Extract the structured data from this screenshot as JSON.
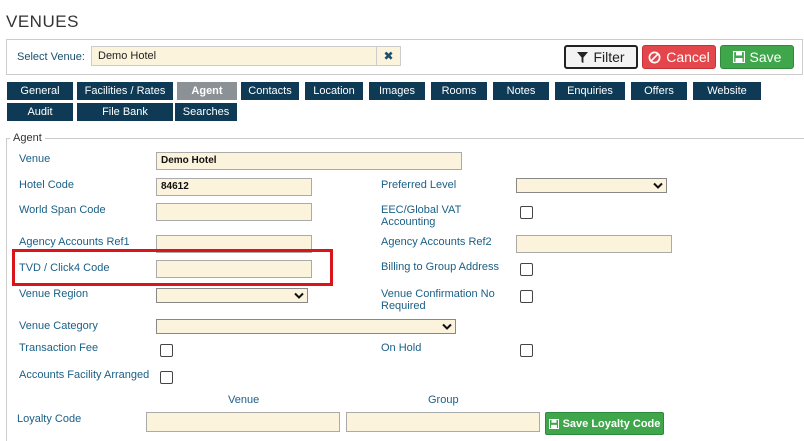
{
  "page": {
    "title": "VENUES"
  },
  "venue_bar": {
    "label": "Select Venue:",
    "selected": "Demo Hotel",
    "clear": "✖"
  },
  "buttons": {
    "filter": "Filter",
    "cancel": "Cancel",
    "save": "Save"
  },
  "tabs": [
    {
      "label": "General"
    },
    {
      "label": "Facilities / Rates"
    },
    {
      "label": "Agent"
    },
    {
      "label": "Contacts"
    },
    {
      "label": "Location"
    },
    {
      "label": "Images"
    },
    {
      "label": "Rooms"
    },
    {
      "label": "Notes"
    },
    {
      "label": "Enquiries"
    },
    {
      "label": "Offers"
    },
    {
      "label": "Website"
    },
    {
      "label": "Audit"
    },
    {
      "label": "File Bank"
    },
    {
      "label": "Searches"
    }
  ],
  "active_tab": "Agent",
  "agent": {
    "legend": "Agent",
    "venue_label": "Venue",
    "venue_value": "Demo Hotel",
    "hotel_code_label": "Hotel Code",
    "hotel_code_value": "84612",
    "preferred_level_label": "Preferred Level",
    "world_span_label": "World Span Code",
    "eec_label": "EEC/Global VAT Accounting",
    "ref1_label": "Agency Accounts Ref1",
    "ref2_label": "Agency Accounts Ref2",
    "tvd_label": "TVD / Click4 Code",
    "billing_label": "Billing to Group Address",
    "region_label": "Venue Region",
    "confirmation_label": "Venue Confirmation No Required",
    "category_label": "Venue Category",
    "transaction_fee_label": "Transaction Fee",
    "on_hold_label": "On Hold",
    "accounts_facility_label": "Accounts Facility Arranged",
    "loyalty_label": "Loyalty Code",
    "venue_col": "Venue",
    "group_col": "Group",
    "save_loyalty": "Save Loyalty Code"
  },
  "colors": {
    "accent_red": "#d9141b",
    "tab_bg": "#0e3a56",
    "save_green": "#3fa64b",
    "cancel_red": "#e4474b"
  }
}
